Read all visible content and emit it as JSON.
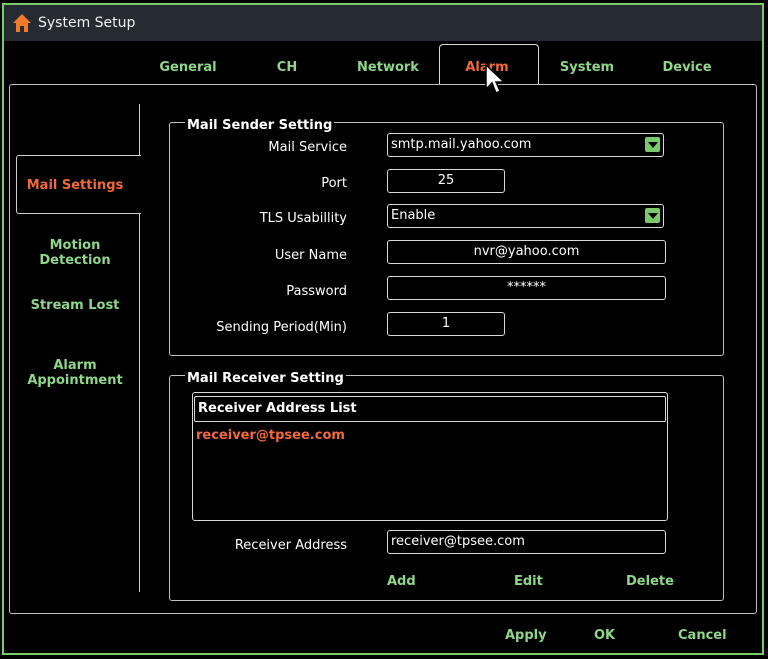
{
  "window": {
    "title": "System Setup",
    "icon": "home-icon"
  },
  "tabs": [
    {
      "label": "General",
      "active": false
    },
    {
      "label": "CH",
      "active": false
    },
    {
      "label": "Network",
      "active": false
    },
    {
      "label": "Alarm",
      "active": true
    },
    {
      "label": "System",
      "active": false
    },
    {
      "label": "Device",
      "active": false
    }
  ],
  "sidebar": {
    "items": [
      {
        "label": "Mail Settings",
        "active": true
      },
      {
        "label": "Motion Detection",
        "active": false
      },
      {
        "label": "Stream Lost",
        "active": false
      },
      {
        "label": "Alarm Appointment",
        "active": false
      }
    ]
  },
  "sender": {
    "title": "Mail Sender Setting",
    "mail_service_label": "Mail Service",
    "mail_service_value": "smtp.mail.yahoo.com",
    "port_label": "Port",
    "port_value": "25",
    "tls_label": "TLS Usabillity",
    "tls_value": "Enable",
    "username_label": "User Name",
    "username_value": "nvr@yahoo.com",
    "password_label": "Password",
    "password_value": "******",
    "period_label": "Sending Period(Min)",
    "period_value": "1"
  },
  "receiver": {
    "title": "Mail Receiver Setting",
    "list_header": "Receiver Address List",
    "list_items": [
      "receiver@tpsee.com"
    ],
    "address_label": "Receiver Address",
    "address_value": "receiver@tpsee.com",
    "add_label": "Add",
    "edit_label": "Edit",
    "delete_label": "Delete"
  },
  "footer": {
    "apply_label": "Apply",
    "ok_label": "OK",
    "cancel_label": "Cancel"
  },
  "colors": {
    "accent": "#f06a3b",
    "green": "#8fd58a",
    "border": "#7ac96b"
  }
}
